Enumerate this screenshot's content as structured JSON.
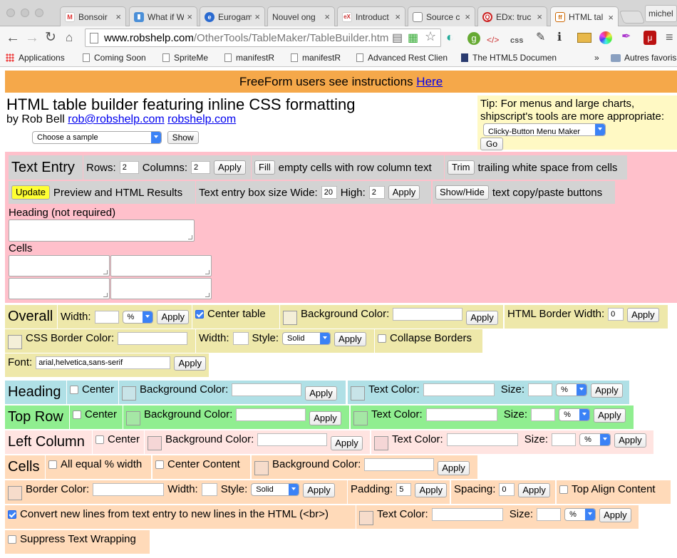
{
  "browser": {
    "tabs": [
      {
        "label": "Bonsoir"
      },
      {
        "label": "What if W"
      },
      {
        "label": "Eurogam"
      },
      {
        "label": "Nouvel ong"
      },
      {
        "label": "Introduct"
      },
      {
        "label": "Source c"
      },
      {
        "label": "EDx: truc"
      },
      {
        "label": "HTML tal"
      }
    ],
    "profile": "michel",
    "url_domain": "www.robshelp.com",
    "url_path": "/OtherTools/TableMaker/TableBuilder.htm",
    "bookmarks": [
      "Applications",
      "Coming Soon",
      "SpriteMe",
      "manifestR",
      "manifestR",
      "Advanced Rest Clien",
      "The HTML5 Documen",
      "Autres favoris"
    ],
    "overflow": "»"
  },
  "page": {
    "banner_text": "FreeForm users see instructions ",
    "banner_link": "Here",
    "title": "HTML table builder featuring inline CSS formatting",
    "byline_prefix": "by Rob Bell ",
    "email": "rob@robshelp.com",
    "site": "robshelp.com",
    "sample_select": "Choose a sample",
    "show_label": "Show",
    "tip_text": "Tip: For menus and large charts, shipscript's tools are more appropriate:",
    "tip_select": "Clicky-Button Menu Maker",
    "go_label": "Go"
  },
  "text_entry": {
    "heading": "Text Entry",
    "rows_label": "Rows:",
    "rows_value": "2",
    "columns_label": "Columns:",
    "columns_value": "2",
    "apply": "Apply",
    "fill_label": "Fill",
    "fill_text": "empty cells with row column text",
    "trim_label": "Trim",
    "trim_text": "trailing white space from cells",
    "update_label": "Update",
    "update_text": "Preview and HTML Results",
    "box_size_label": "Text entry box size Wide:",
    "wide_value": "20",
    "high_label": "High:",
    "high_value": "2",
    "showhide_label": "Show/Hide",
    "showhide_text": "text copy/paste buttons",
    "heading_field_label": "Heading (not required)",
    "cells_label": "Cells"
  },
  "overall": {
    "heading": "Overall",
    "width_label": "Width:",
    "width_unit": "%",
    "center_label": "Center table",
    "bg_label": "Background Color:",
    "html_border_label": "HTML Border Width:",
    "html_border_value": "0",
    "css_border_label": "CSS Border Color:",
    "style_label": "Style:",
    "style_value": "Solid",
    "collapse_label": "Collapse Borders",
    "font_label": "Font:",
    "font_value": "arial,helvetica,sans-serif",
    "apply": "Apply"
  },
  "heading_row": {
    "heading": "Heading",
    "center_label": "Center",
    "bg_label": "Background Color:",
    "text_color_label": "Text Color:",
    "size_label": "Size:",
    "size_unit": "%",
    "apply": "Apply"
  },
  "top_row": {
    "heading": "Top Row",
    "center_label": "Center",
    "bg_label": "Background Color:",
    "text_color_label": "Text Color:",
    "size_label": "Size:",
    "size_unit": "%",
    "apply": "Apply"
  },
  "left_column": {
    "heading": "Left Column",
    "center_label": "Center",
    "bg_label": "Background Color:",
    "text_color_label": "Text Color:",
    "size_label": "Size:",
    "size_unit": "%",
    "apply": "Apply"
  },
  "cells": {
    "heading": "Cells",
    "equal_label": "All equal % width",
    "center_content_label": "Center Content",
    "bg_label": "Background Color:",
    "border_color_label": "Border Color:",
    "width_label": "Width:",
    "style_label": "Style:",
    "style_value": "Solid",
    "padding_label": "Padding:",
    "padding_value": "5",
    "spacing_label": "Spacing:",
    "spacing_value": "0",
    "top_align_label": "Top Align Content",
    "newlines_label": "Convert new lines from text entry to new lines in the HTML (<br>)",
    "text_color_label": "Text Color:",
    "size_label": "Size:",
    "size_unit": "%",
    "suppress_label": "Suppress Text Wrapping",
    "apply": "Apply"
  }
}
